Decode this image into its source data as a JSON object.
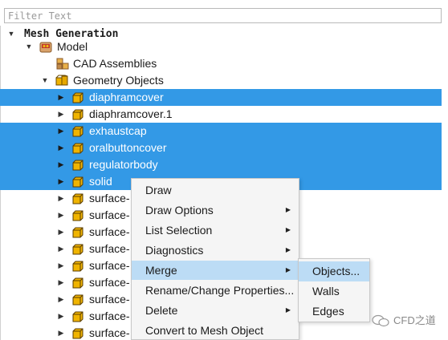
{
  "filter": {
    "placeholder": "Filter Text",
    "value": ""
  },
  "tree": {
    "root": {
      "label": "Mesh Generation",
      "expanded": true
    },
    "model": {
      "label": "Model",
      "icon": "model-icon",
      "expanded": true
    },
    "cad": {
      "label": "CAD Assemblies",
      "icon": "cad-assemblies-icon"
    },
    "geometry": {
      "label": "Geometry Objects",
      "icon": "geometry-objects-icon",
      "expanded": true
    },
    "objects": [
      {
        "label": "diaphramcover",
        "selected": true
      },
      {
        "label": "diaphramcover.1",
        "selected": false
      },
      {
        "label": "exhaustcap",
        "selected": true
      },
      {
        "label": "oralbuttoncover",
        "selected": true
      },
      {
        "label": "regulatorbody",
        "selected": true
      },
      {
        "label": "solid",
        "selected": true
      },
      {
        "label": "surface-",
        "selected": false
      },
      {
        "label": "surface-",
        "selected": false
      },
      {
        "label": "surface-",
        "selected": false
      },
      {
        "label": "surface-",
        "selected": false
      },
      {
        "label": "surface-",
        "selected": false
      },
      {
        "label": "surface-",
        "selected": false
      },
      {
        "label": "surface-",
        "selected": false
      },
      {
        "label": "surface-",
        "selected": false
      },
      {
        "label": "surface-",
        "selected": false
      }
    ]
  },
  "context_menu": {
    "items": [
      {
        "label": "Draw",
        "submenu": false
      },
      {
        "label": "Draw Options",
        "submenu": true
      },
      {
        "label": "List Selection",
        "submenu": true
      },
      {
        "label": "Diagnostics",
        "submenu": true
      },
      {
        "label": "Merge",
        "submenu": true,
        "highlighted": true
      },
      {
        "label": "Rename/Change Properties...",
        "submenu": false
      },
      {
        "label": "Delete",
        "submenu": true
      },
      {
        "label": "Convert to Mesh Object",
        "submenu": false
      }
    ]
  },
  "merge_submenu": {
    "items": [
      {
        "label": "Objects...",
        "highlighted": true
      },
      {
        "label": "Walls"
      },
      {
        "label": "Edges"
      }
    ]
  },
  "watermark": {
    "text": "CFD之道"
  },
  "colors": {
    "selection": "#3399e6",
    "menu_highlight": "#bcdcf5",
    "object_icon": "#f0b400"
  }
}
